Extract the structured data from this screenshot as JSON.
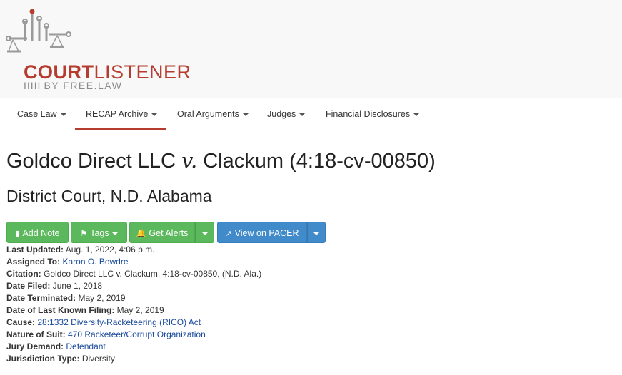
{
  "logo": {
    "court": "COURT",
    "listener": "LISTENER",
    "bars": "IIIII",
    "sub": "BY FREE.LAW"
  },
  "nav": {
    "items": [
      {
        "label": "Case Law"
      },
      {
        "label": "RECAP Archive"
      },
      {
        "label": "Oral Arguments"
      },
      {
        "label": "Judges"
      },
      {
        "label": "Financial Disclosures"
      }
    ]
  },
  "case": {
    "title_left": "Goldco Direct LLC",
    "title_v": "v.",
    "title_right": "Clackum (4:18-cv-00850)",
    "court": "District Court, N.D. Alabama"
  },
  "buttons": {
    "add_note": "Add Note",
    "tags": "Tags",
    "get_alerts": "Get Alerts",
    "view_pacer": "View on PACER"
  },
  "details": {
    "last_updated_label": "Last Updated:",
    "last_updated_value": "Aug. 1, 2022, 4:06 p.m.",
    "assigned_label": "Assigned To:",
    "assigned_value": "Karon O. Bowdre",
    "citation_label": "Citation:",
    "citation_value": "Goldco Direct LLC v. Clackum, 4:18-cv-00850, (N.D. Ala.)",
    "filed_label": "Date Filed:",
    "filed_value": "June 1, 2018",
    "terminated_label": "Date Terminated:",
    "terminated_value": "May 2, 2019",
    "last_filing_label": "Date of Last Known Filing:",
    "last_filing_value": "May 2, 2019",
    "cause_label": "Cause:",
    "cause_value": "28:1332 Diversity-Racketeering (RICO) Act",
    "nature_label": "Nature of Suit:",
    "nature_value": "470 Racketeer/Corrupt Organization",
    "jury_label": "Jury Demand:",
    "jury_value": "Defendant",
    "jurisdiction_label": "Jurisdiction Type:",
    "jurisdiction_value": "Diversity"
  },
  "colors": {
    "brand_red": "#b53c2f",
    "green": "#5cb85c",
    "blue": "#428bca",
    "link": "#1a4a9c"
  }
}
